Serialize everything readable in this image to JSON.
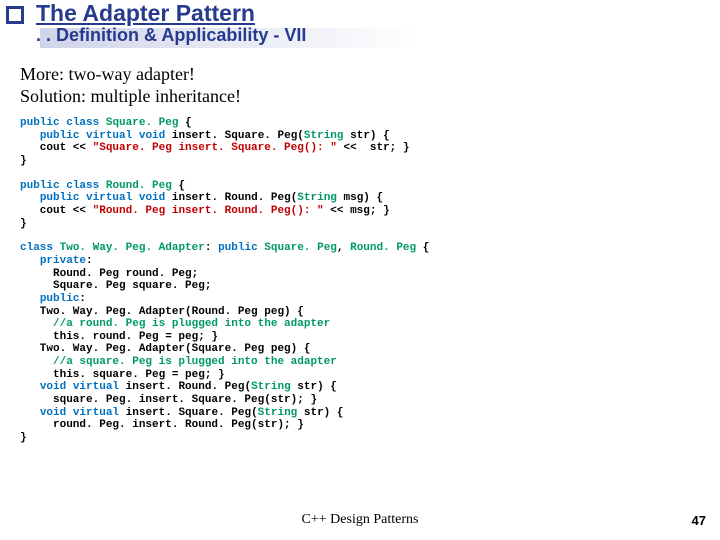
{
  "header": {
    "title": "The Adapter Pattern",
    "subtitle": ". . Definition & Applicability - VII"
  },
  "intro": {
    "l1": "More: two-way adapter!",
    "l2": "Solution: multiple inheritance!"
  },
  "kw": {
    "public": "public",
    "class": "class",
    "virtual": "virtual",
    "void": "void",
    "private": "private"
  },
  "ty": {
    "sq": "Square. Peg",
    "rd": "Round. Peg",
    "ad": "Two. Way. Peg. Adapter",
    "str": "String",
    "rdn": "Round. Peg",
    "sqn": "Square. Peg"
  },
  "c1": {
    "m1": "insert. Square. Peg(",
    "m2": " str) {",
    "body": "   cout << ",
    "lit": "\"Square. Peg insert. Square. Peg(): \"",
    "tail": " <<  str; }"
  },
  "c2": {
    "m1": "insert. Round. Peg(",
    "m2": " msg) {",
    "body": "   cout << ",
    "lit": "\"Round. Peg insert. Round. Peg(): \"",
    "tail": " << msg; }"
  },
  "c3": {
    "open": " {",
    "f1": "     Round. Peg round. Peg;",
    "f2": "     Square. Peg square. Peg;",
    "ctor1": "   Two. Way. Peg. Adapter(Round. Peg peg) {",
    "cm1": "     //a round. Peg is plugged into the adapter",
    "b1": "     this. round. Peg = peg; }",
    "ctor2": "   Two. Way. Peg. Adapter(Square. Peg peg) {",
    "cm2": "     //a square. Peg is plugged into the adapter",
    "b2": "     this. square. Peg = peg; }",
    "m1a": "   ",
    "m1b": " insert. Round. Peg(",
    "m1c": " str) {",
    "m1body": "     square. Peg. insert. Square. Peg(str); }",
    "m2a": "   ",
    "m2b": " insert. Square. Peg(",
    "m2c": " str) {",
    "m2body": "     round. Peg. insert. Round. Peg(str); }"
  },
  "brace": {
    "open": " {",
    "close": "}"
  },
  "footer": {
    "center": "C++ Design Patterns",
    "page": "47"
  }
}
